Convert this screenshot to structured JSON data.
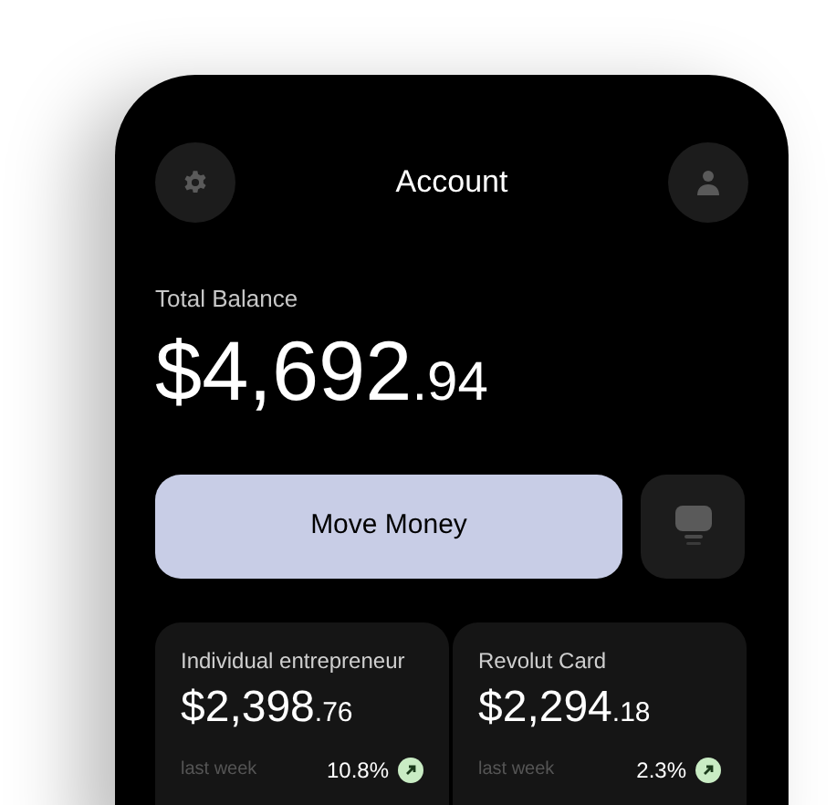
{
  "header": {
    "title": "Account"
  },
  "balance": {
    "label": "Total Balance",
    "whole": "$4,692",
    "cents": ".94"
  },
  "actions": {
    "primary": "Move Money"
  },
  "accounts": [
    {
      "name": "Individual entrepreneur",
      "whole": "$2,398",
      "cents": ".76",
      "period": "last week",
      "change": "10.8%"
    },
    {
      "name": "Revolut Card",
      "whole": "$2,294",
      "cents": ".18",
      "period": "last week",
      "change": "2.3%"
    }
  ]
}
